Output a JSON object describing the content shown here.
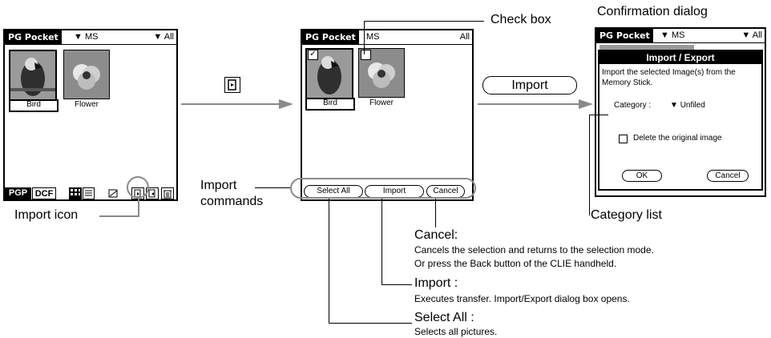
{
  "screen1": {
    "app": "PG Pocket",
    "source": "MS",
    "filter": "All",
    "items": [
      {
        "label": "Bird"
      },
      {
        "label": "Flower"
      }
    ],
    "modes": [
      "PGP",
      "DCF"
    ]
  },
  "screen2": {
    "app": "PG Pocket",
    "source": "MS",
    "filter": "All",
    "items": [
      {
        "label": "Bird"
      },
      {
        "label": "Flower"
      }
    ],
    "commands": [
      "Select All",
      "Import",
      "Cancel"
    ]
  },
  "screen3": {
    "app": "PG Pocket",
    "source": "MS",
    "filter": "All",
    "dialog": {
      "title": "Import / Export",
      "message": "Import the selected Image(s) from the Memory Stick.",
      "category_label": "Category :",
      "category_value": "Unfiled",
      "delete_label": "Delete the original image",
      "ok": "OK",
      "cancel": "Cancel"
    }
  },
  "flow": {
    "import_button": "Import"
  },
  "annotations": {
    "check_box": "Check box",
    "confirmation_dialog": "Confirmation dialog",
    "import_icon": "Import icon",
    "import_commands_1": "Import",
    "import_commands_2": "commands",
    "category_list": "Category list",
    "cancel_title": "Cancel:",
    "cancel_desc1": "Cancels the selection and returns to the selection mode.",
    "cancel_desc2": "Or press the Back button of the CLIE handheld.",
    "import_title": "Import :",
    "import_desc": "Executes transfer. Import/Export dialog box opens.",
    "selectall_title": "Select All :",
    "selectall_desc": "Selects all pictures."
  },
  "colors": {
    "callout_gray": "#8a8a8a",
    "ink": "#000000"
  }
}
